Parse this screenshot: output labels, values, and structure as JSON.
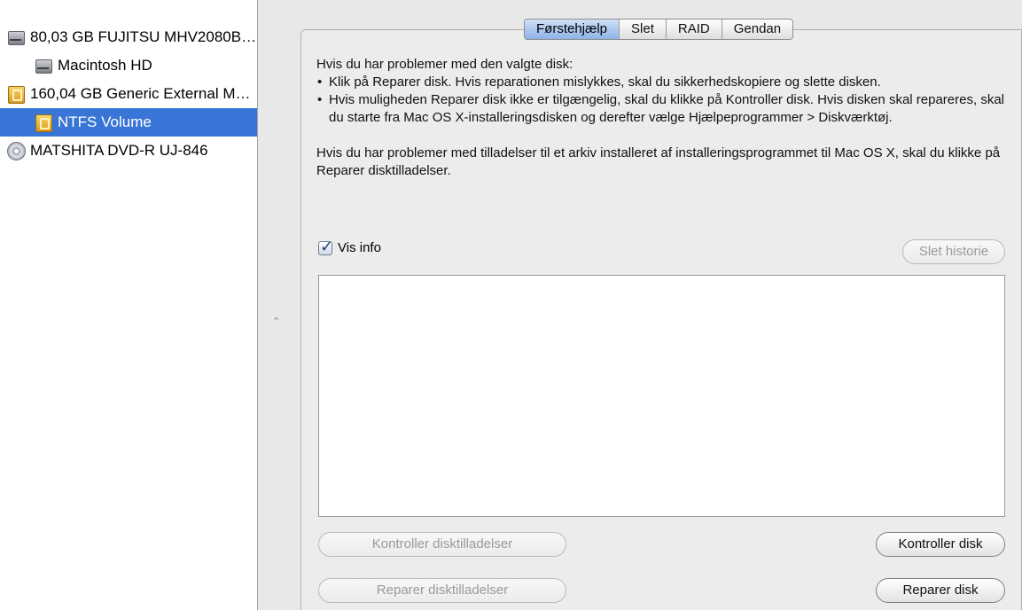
{
  "sidebar": {
    "items": [
      {
        "label": "80,03 GB FUJITSU MHV2080BH...",
        "icon": "hard-disk-icon"
      },
      {
        "label": "Macintosh HD",
        "icon": "hard-disk-volume-icon"
      },
      {
        "label": "160,04 GB Generic External Media",
        "icon": "external-disk-icon"
      },
      {
        "label": "NTFS Volume",
        "icon": "external-volume-icon",
        "selected": true
      },
      {
        "label": "MATSHITA DVD-R UJ-846",
        "icon": "optical-drive-icon"
      }
    ]
  },
  "tabs": [
    {
      "label": "Førstehjælp",
      "active": true
    },
    {
      "label": "Slet"
    },
    {
      "label": "RAID"
    },
    {
      "label": "Gendan"
    }
  ],
  "help": {
    "intro": "Hvis du har problemer med den valgte disk:",
    "bullets": [
      "Klik på Reparer disk. Hvis reparationen mislykkes, skal du sikkerhedskopiere og slette disken.",
      "Hvis muligheden Reparer disk ikke er tilgængelig, skal du klikke på Kontroller disk. Hvis disken skal repareres, skal du starte fra Mac OS X-installeringsdisken og derefter vælge Hjælpeprogrammer > Diskværktøj."
    ],
    "permissions": "Hvis du har problemer med tilladelser til et arkiv installeret af installeringsprogrammet til Mac OS X, skal du klikke på Reparer disktilladelser."
  },
  "vis_info": {
    "label": "Vis info",
    "checked": true
  },
  "buttons": {
    "clear_history": "Slet historie",
    "verify_permissions": "Kontroller disktilladelser",
    "repair_permissions": "Reparer disktilladelser",
    "verify_disk": "Kontroller disk",
    "repair_disk": "Reparer disk"
  },
  "colors": {
    "selection": "#3875d7",
    "active_tab": "#8db3e8"
  }
}
